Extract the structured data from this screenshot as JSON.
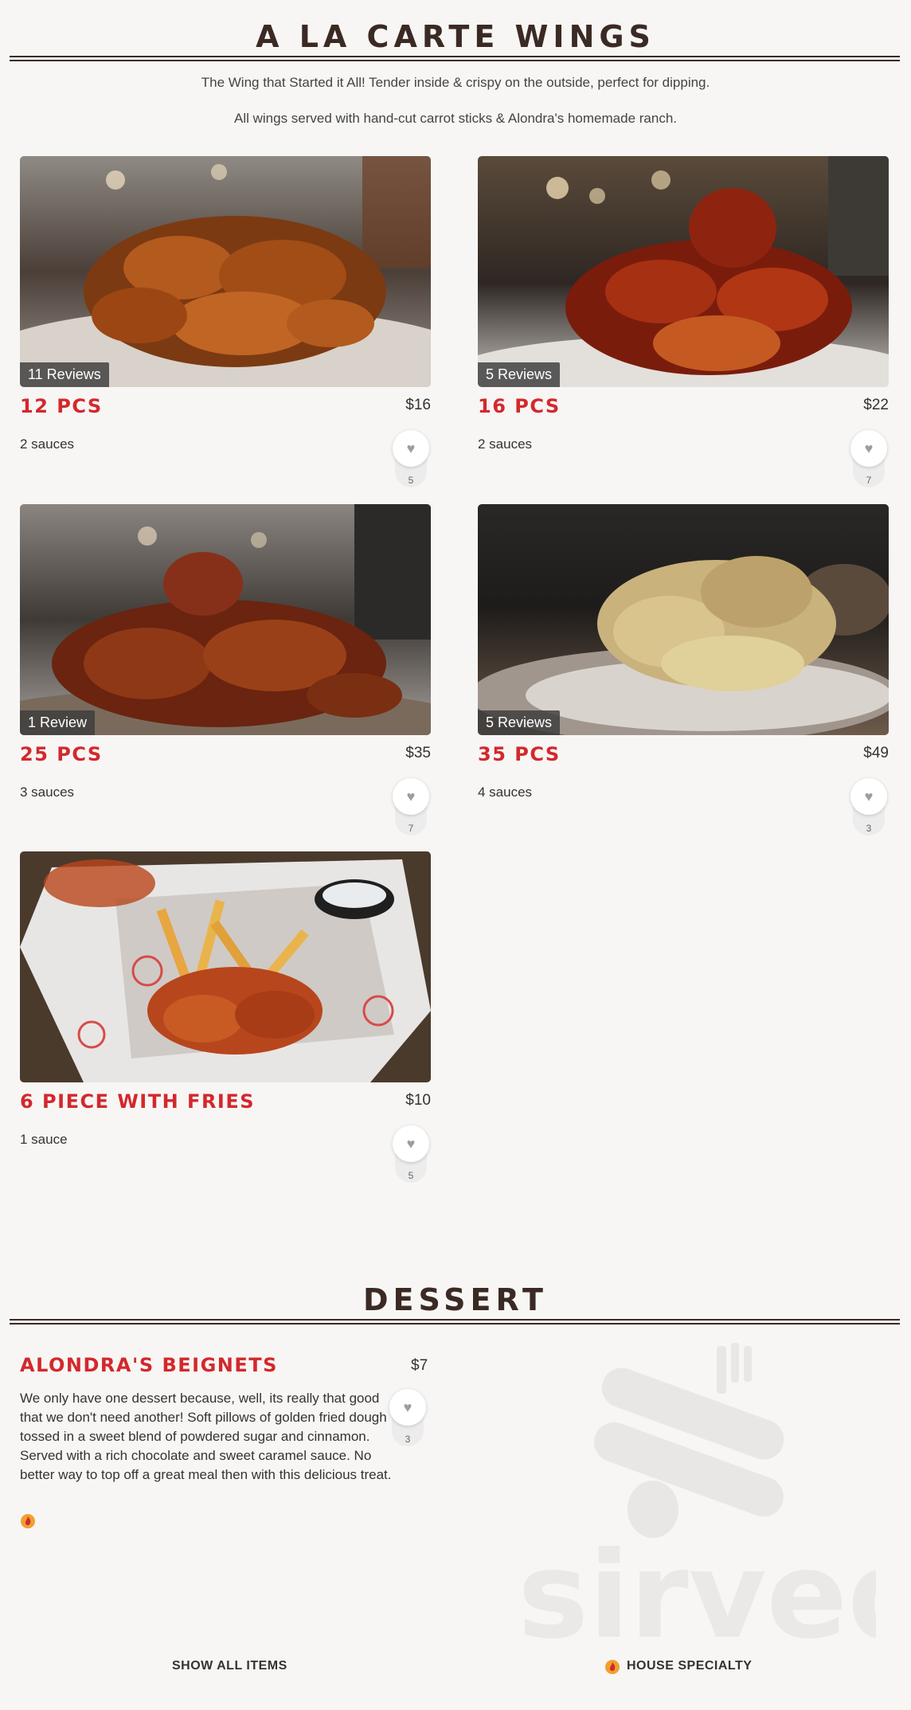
{
  "wings": {
    "title": "A LA CARTE WINGS",
    "intro_line1": "The Wing that Started it All! Tender inside & crispy on the outside, perfect for dipping.",
    "intro_line2": "All wings served with hand-cut carrot sticks & Alondra's homemade ranch.",
    "items": [
      {
        "name": "12 PCS",
        "price": "$16",
        "desc": "2 sauces",
        "reviews": "11 Reviews",
        "likes": "5"
      },
      {
        "name": "16 PCS",
        "price": "$22",
        "desc": "2 sauces",
        "reviews": "5 Reviews",
        "likes": "7"
      },
      {
        "name": "25 PCS",
        "price": "$35",
        "desc": "3 sauces",
        "reviews": "1 Review",
        "likes": "7"
      },
      {
        "name": "35 PCS",
        "price": "$49",
        "desc": "4 sauces",
        "reviews": "5 Reviews",
        "likes": "3"
      },
      {
        "name": "6 PIECE WITH FRIES",
        "price": "$10",
        "desc": "1 sauce",
        "likes": "5"
      }
    ]
  },
  "dessert": {
    "title": "DESSERT",
    "item": {
      "name": "ALONDRA'S BEIGNETS",
      "price": "$7",
      "desc": "We only have one dessert because, well, its really that good that we don't need another! Soft pillows of golden fried dough tossed in a sweet blend of powdered sugar and cinnamon. Served with a rich chocolate and sweet caramel sauce. No better way to top off a great meal then with this delicious treat.",
      "likes": "3"
    }
  },
  "watermark": {
    "brand": "sirved"
  },
  "footer": {
    "show_all": "SHOW ALL ITEMS",
    "house_specialty": "HOUSE SPECIALTY"
  },
  "colors": {
    "accent": "#d3282d",
    "heading": "#3b2a24",
    "specialty_icon": "#f0a030"
  },
  "icons": {
    "like": "heart-icon",
    "specialty": "flame-icon"
  }
}
